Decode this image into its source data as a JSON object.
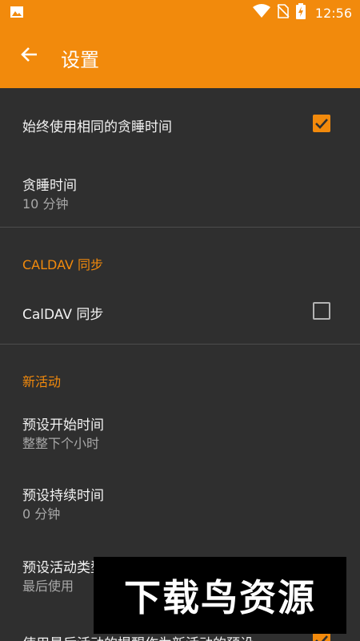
{
  "status_bar": {
    "time": "12:56",
    "icons": [
      "image-icon",
      "wifi-icon",
      "no-sim-icon",
      "battery-charging-icon"
    ]
  },
  "toolbar": {
    "back_icon": "arrow-left-icon",
    "title": "设置"
  },
  "settings": {
    "same_snooze": {
      "title": "始终使用相同的贪睡时间",
      "checked": true
    },
    "snooze_time": {
      "title": "贪睡时间",
      "value": "10 分钟"
    },
    "caldav_section": {
      "header": "CALDAV 同步"
    },
    "caldav_sync": {
      "title": "CalDAV 同步",
      "checked": false
    },
    "new_event_section": {
      "header": "新活动"
    },
    "default_start": {
      "title": "预设开始时间",
      "value": "整整下个小时"
    },
    "default_duration": {
      "title": "预设持续时间",
      "value": "0 分钟"
    },
    "default_type": {
      "title": "预设活动类型",
      "value": "最后使用"
    },
    "use_last_reminder": {
      "title": "使用最后活动的提醒作为新活动的预设",
      "checked": true
    }
  },
  "watermark": {
    "text": "下载鸟资源"
  },
  "colors": {
    "accent": "#f28a0c",
    "background": "#2f2f2f",
    "secondary_text": "#a8a8a8"
  }
}
